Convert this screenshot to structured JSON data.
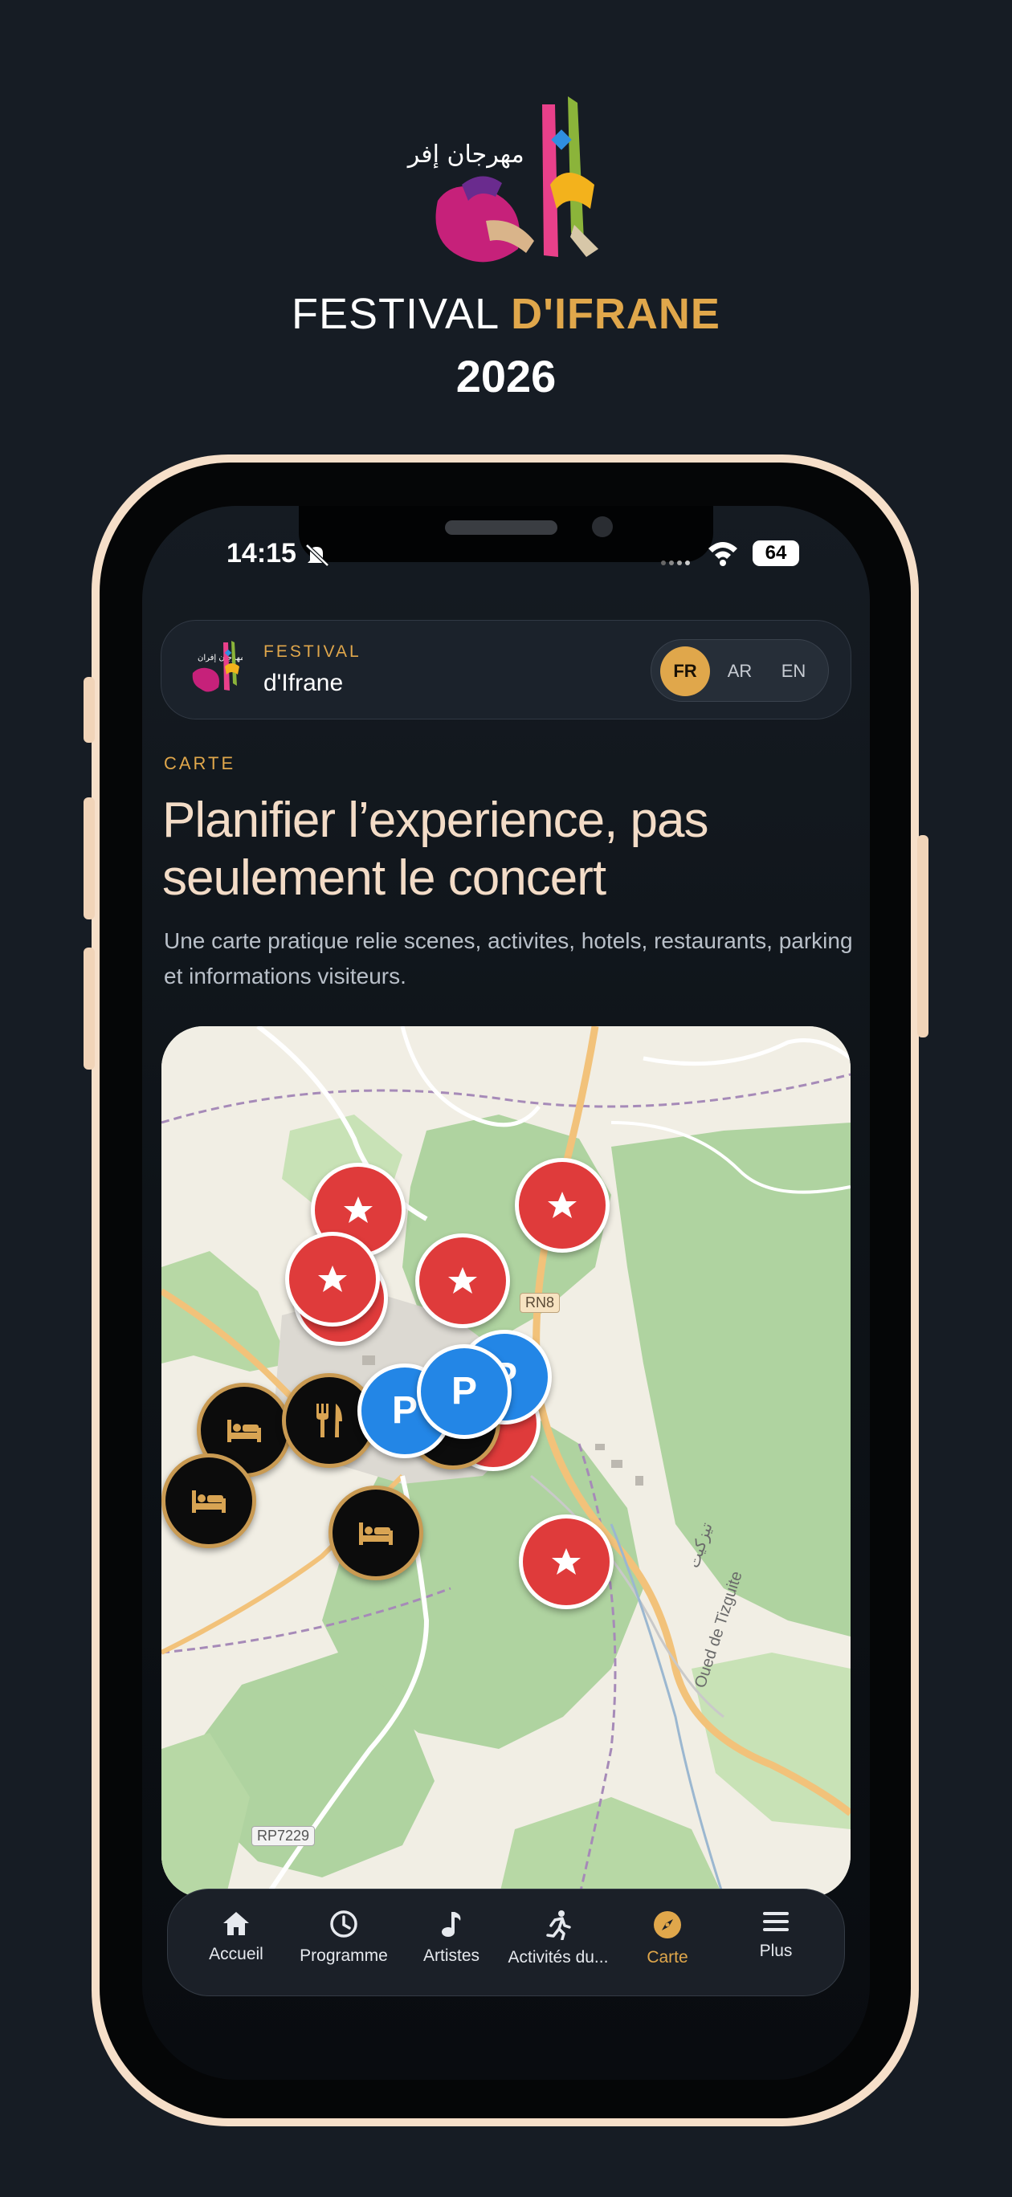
{
  "promo": {
    "logo_arabic": "مهرجان إفران",
    "title_plain": "FESTIVAL ",
    "title_accent": "D'IFRANE",
    "year": "2026"
  },
  "status_bar": {
    "time": "14:15",
    "battery": "64",
    "icons": [
      "mute-bell-icon",
      "signal-dots-icon",
      "wifi-icon",
      "battery-icon"
    ]
  },
  "header": {
    "logo_arabic": "مهرجان إفران",
    "kicker": "FESTIVAL",
    "name": "d'Ifrane",
    "languages": [
      {
        "label": "FR",
        "active": true
      },
      {
        "label": "AR",
        "active": false
      },
      {
        "label": "EN",
        "active": false
      }
    ]
  },
  "hero": {
    "eyebrow": "CARTE",
    "headline": "Planifier l’experience, pas seulement le concert",
    "intro": "Une carte pratique relie scenes, activites, hotels, restaurants, parking et informations visiteurs."
  },
  "map": {
    "road_labels": [
      "RN8",
      "RP7229"
    ],
    "place_labels": [
      "Oued de Tizguite",
      "تيزكيت"
    ],
    "marker_types": {
      "stage": {
        "icon": "star-icon",
        "color": "#df3b3b"
      },
      "hotel": {
        "icon": "bed-icon",
        "color": "#0c0c0c"
      },
      "restaurant": {
        "icon": "fork-knife-icon",
        "color": "#0c0c0c"
      },
      "parking": {
        "icon": "parking-icon",
        "label": "P",
        "color": "#2386e6"
      }
    },
    "colors": {
      "forest": "#afd3a0",
      "land": "#f1eee4",
      "road_major": "#f2c27a",
      "road_minor": "#ffffff",
      "boundary": "#a68ab8"
    }
  },
  "nav": {
    "items": [
      {
        "label": "Accueil",
        "icon": "home-icon",
        "active": false
      },
      {
        "label": "Programme",
        "icon": "clock-icon",
        "active": false
      },
      {
        "label": "Artistes",
        "icon": "music-note-icon",
        "active": false
      },
      {
        "label": "Activités du...",
        "icon": "running-icon",
        "active": false
      },
      {
        "label": "Carte",
        "icon": "compass-icon",
        "active": true
      },
      {
        "label": "Plus",
        "icon": "menu-icon",
        "active": false
      }
    ]
  },
  "theme": {
    "accent": "#e0a74b",
    "background": "#161c24",
    "frame": "#f6dfc9"
  }
}
